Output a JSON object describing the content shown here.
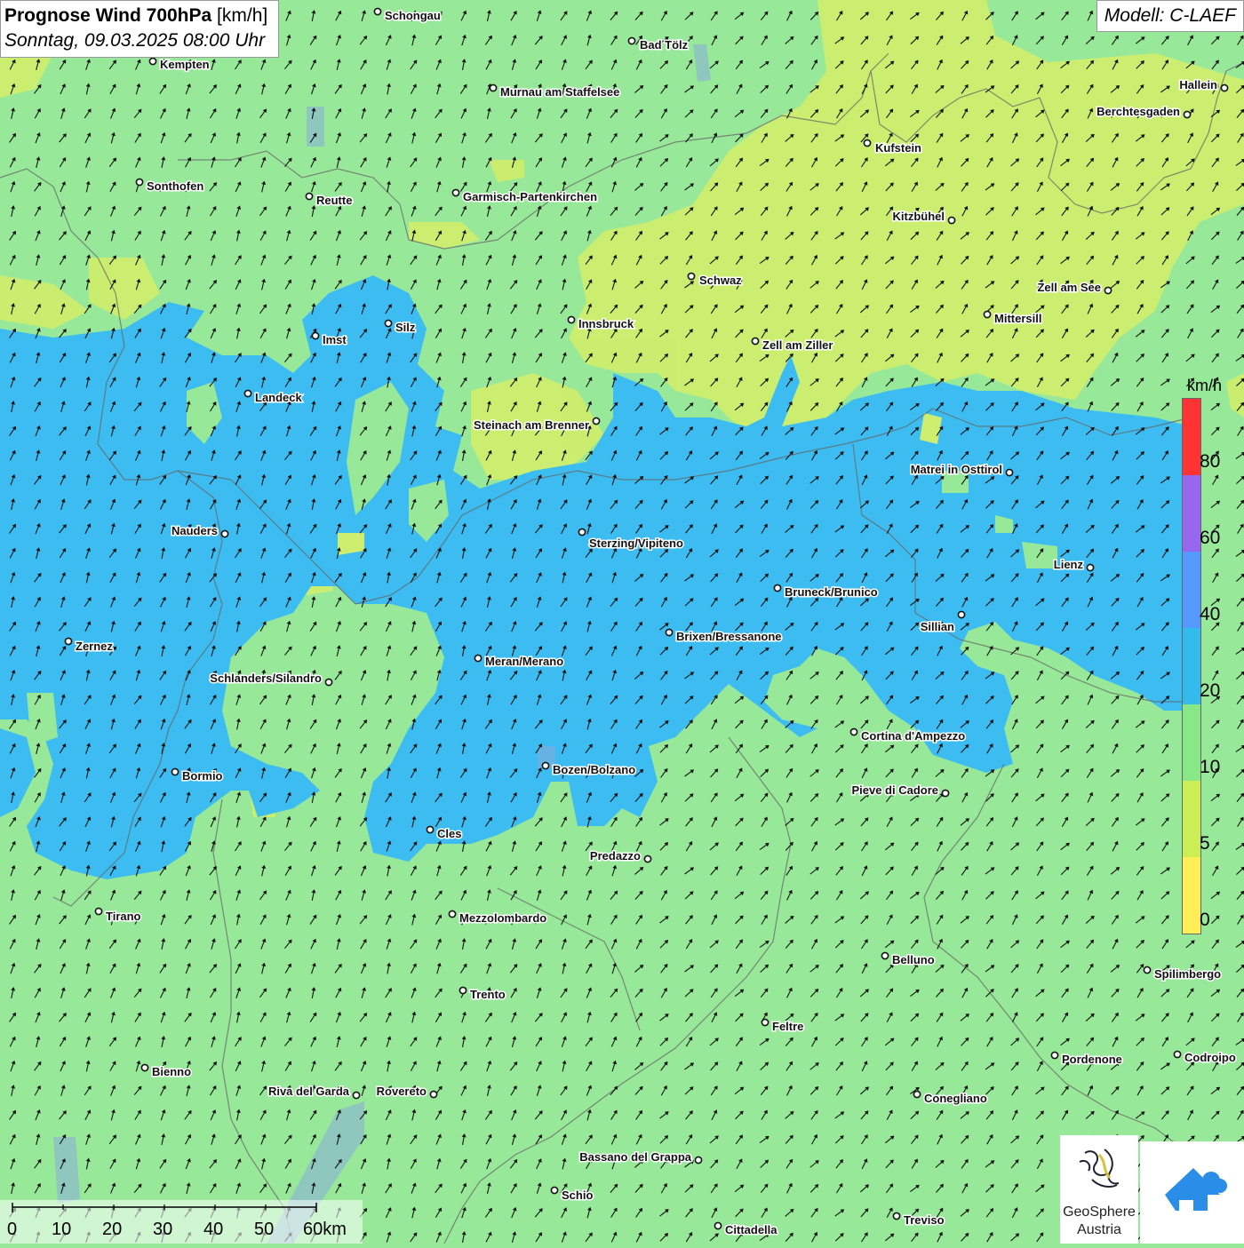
{
  "header": {
    "title": "Prognose Wind 700hPa",
    "unit": "[km/h]",
    "datetime": "Sonntag, 09.03.2025 08:00 Uhr"
  },
  "model": "Modell: C-LAEF",
  "legend": {
    "unit": "km/h",
    "labels": [
      "80",
      "60",
      "40",
      "20",
      "10",
      "5",
      "0"
    ],
    "colors": [
      "#ff3333",
      "#9966ee",
      "#5599ff",
      "#33bbee",
      "#88e888",
      "#ccee55",
      "#ffee55"
    ]
  },
  "scale": {
    "labels": [
      "0",
      "10",
      "20",
      "30",
      "40",
      "50",
      "60km"
    ]
  },
  "logo": {
    "geosphere_line1": "GeoSphere",
    "geosphere_line2": "Austria"
  },
  "colors": {
    "calm": "#ccee66",
    "light": "#98e89a",
    "moderate": "#3cbcf0",
    "arrow": "#111111"
  },
  "cities": [
    {
      "name": "Schongau"
    },
    {
      "name": "Bad Tölz"
    },
    {
      "name": "Kempten"
    },
    {
      "name": "Murnau am Staffelsee"
    },
    {
      "name": "Hallein"
    },
    {
      "name": "Berchtesgaden"
    },
    {
      "name": "Kufstein"
    },
    {
      "name": "Sonthofen"
    },
    {
      "name": "Reutte"
    },
    {
      "name": "Garmisch-Partenkirchen"
    },
    {
      "name": "Kitzbühel"
    },
    {
      "name": "Schwaz"
    },
    {
      "name": "Zell am See"
    },
    {
      "name": "Innsbruck"
    },
    {
      "name": "Mittersill"
    },
    {
      "name": "Silz"
    },
    {
      "name": "Imst"
    },
    {
      "name": "Zell am Ziller"
    },
    {
      "name": "Landeck"
    },
    {
      "name": "Steinach am Brenner"
    },
    {
      "name": "Matrei in Osttirol"
    },
    {
      "name": "Nauders"
    },
    {
      "name": "Sterzing/Vipiteno"
    },
    {
      "name": "Lienz"
    },
    {
      "name": "Bruneck/Brunico"
    },
    {
      "name": "Sillian"
    },
    {
      "name": "Zernez"
    },
    {
      "name": "Brixen/Bressanone"
    },
    {
      "name": "Meran/Merano"
    },
    {
      "name": "Schlanders/Silandro"
    },
    {
      "name": "Cortina d'Ampezzo"
    },
    {
      "name": "Bozen/Bolzano"
    },
    {
      "name": "Bormio"
    },
    {
      "name": "Pieve di Cadore"
    },
    {
      "name": "Cles"
    },
    {
      "name": "Predazzo"
    },
    {
      "name": "Tirano"
    },
    {
      "name": "Mezzolombardo"
    },
    {
      "name": "Belluno"
    },
    {
      "name": "Spilimbergo"
    },
    {
      "name": "Trento"
    },
    {
      "name": "Feltre"
    },
    {
      "name": "Pordenone"
    },
    {
      "name": "Codroipo"
    },
    {
      "name": "Bienno"
    },
    {
      "name": "Riva del Garda"
    },
    {
      "name": "Rovereto"
    },
    {
      "name": "Conegliano"
    },
    {
      "name": "Bassano del Grappa"
    },
    {
      "name": "Schio"
    },
    {
      "name": "Treviso"
    },
    {
      "name": "Cittadella"
    }
  ]
}
